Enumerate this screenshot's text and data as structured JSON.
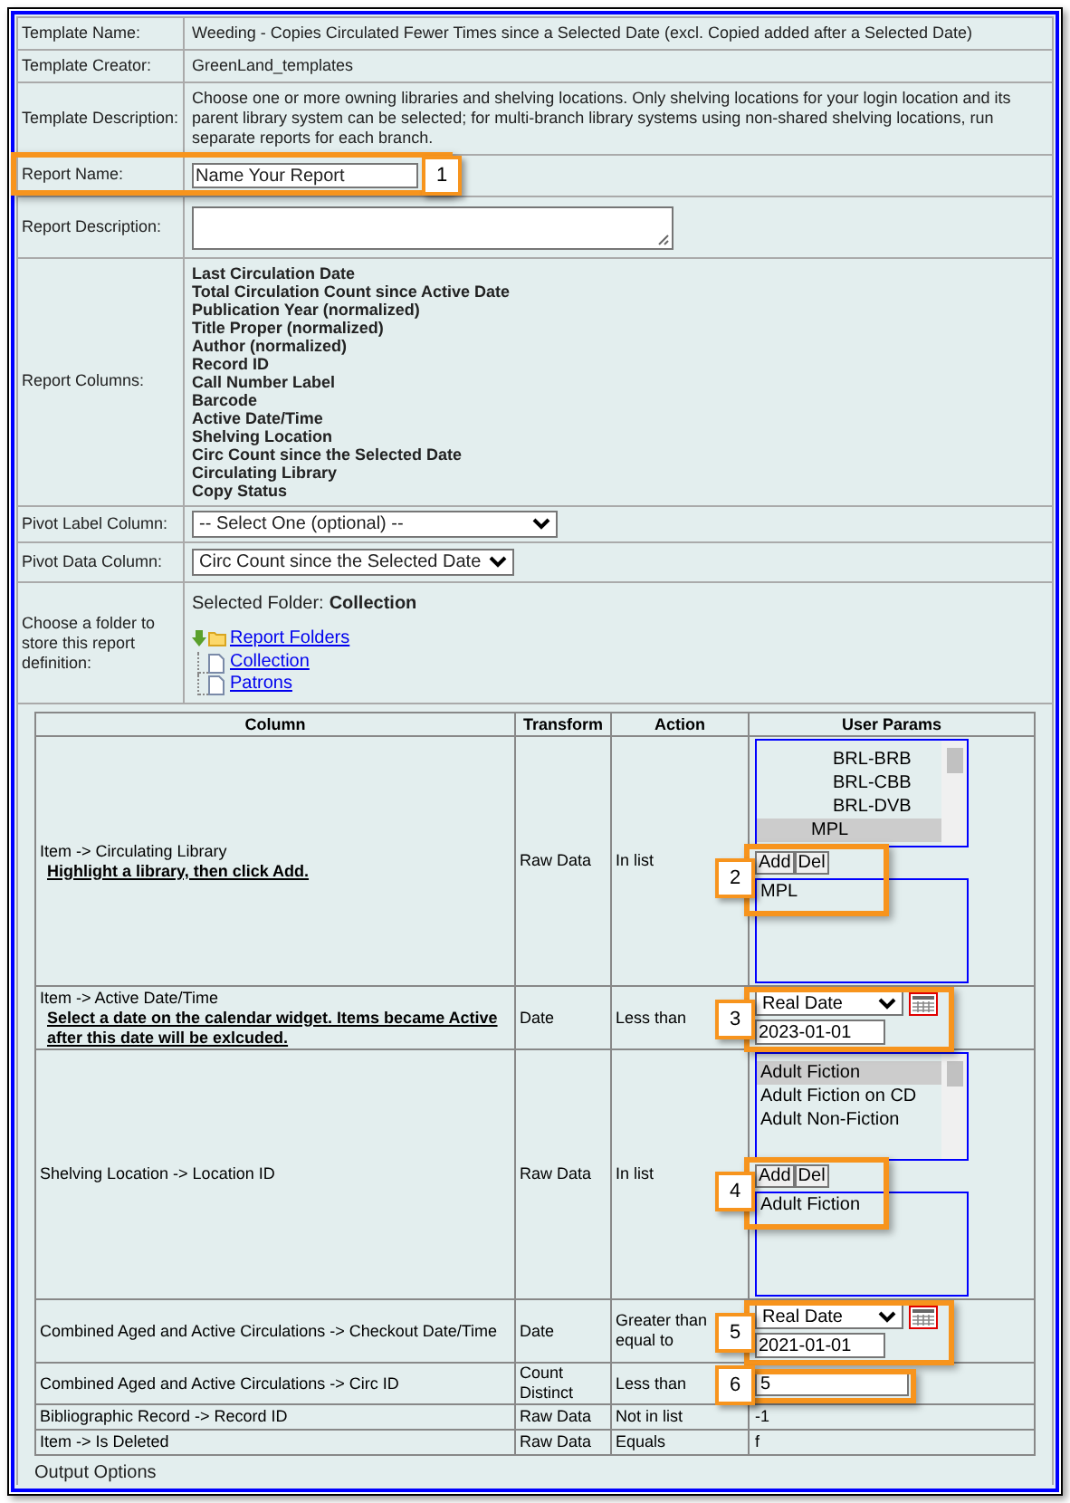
{
  "info_rows": [
    {
      "label": "Template Name:",
      "value": "Weeding - Copies Circulated Fewer Times since a Selected Date (excl. Copied added after a Selected Date)"
    },
    {
      "label": "Template Creator:",
      "value": "GreenLand_templates"
    },
    {
      "label": "Template Description:",
      "value": "Choose one or more owning libraries and shelving locations. Only shelving locations for your login location and its parent library system can be selected; for multi-branch library systems using non-shared shelving locations, run separate reports for each branch."
    }
  ],
  "report_name": {
    "label": "Report Name:",
    "value": "Name Your Report",
    "callout": "1"
  },
  "report_description": {
    "label": "Report Description:"
  },
  "report_columns": {
    "label": "Report Columns:",
    "items": [
      "Last Circulation Date",
      "Total Circulation Count since Active Date",
      "Publication Year (normalized)",
      "Title Proper (normalized)",
      "Author (normalized)",
      "Record ID",
      "Call Number Label",
      "Barcode",
      "Active Date/Time",
      "Shelving Location",
      "Circ Count since the Selected Date",
      "Circulating Library",
      "Copy Status"
    ]
  },
  "pivot_label": {
    "label": "Pivot Label Column:",
    "value": "-- Select One (optional) --"
  },
  "pivot_data": {
    "label": "Pivot Data Column:",
    "value": "Circ Count since the Selected Date"
  },
  "folder": {
    "label": "Choose a folder to store this report definition:",
    "selected_label": "Selected Folder:",
    "selected_value": "Collection",
    "tree": {
      "label": "Report Folders",
      "children": [
        {
          "label": "Collection"
        },
        {
          "label": "Patrons"
        }
      ]
    }
  },
  "params_table": {
    "columns": [
      "Column",
      "Transform",
      "Action",
      "User Params"
    ],
    "rows": [
      {
        "column": "Item -> Circulating Library",
        "hint": "Highlight a library, then click Add.",
        "transform": "Raw Data",
        "action": "In list",
        "callout": "2",
        "param": {
          "kind": "listbox",
          "options": [
            {
              "label": "BRL-BRB",
              "selected": false
            },
            {
              "label": "BRL-CBB",
              "selected": false
            },
            {
              "label": "BRL-DVB",
              "selected": false
            },
            {
              "label": "MPL",
              "selected": true
            }
          ],
          "add": "Add",
          "del": "Del",
          "chosen": [
            "MPL"
          ],
          "centered": true
        }
      },
      {
        "column": "Item -> Active Date/Time",
        "hint": "Select a date on the calendar widget. Items became Active after this date will be exlcuded.",
        "transform": "Date",
        "action": "Less than",
        "callout": "3",
        "param": {
          "kind": "date",
          "type": "Real Date",
          "value": "2023-01-01"
        }
      },
      {
        "column": "Shelving Location -> Location ID",
        "transform": "Raw Data",
        "action": "In list",
        "callout": "4",
        "param": {
          "kind": "listbox",
          "options": [
            {
              "label": "Adult Fiction",
              "selected": true
            },
            {
              "label": "Adult Fiction on CD",
              "selected": false
            },
            {
              "label": "Adult Non-Fiction",
              "selected": false
            }
          ],
          "add": "Add",
          "del": "Del",
          "chosen": [
            "Adult Fiction"
          ],
          "centered": false
        }
      },
      {
        "column": "Combined Aged and Active Circulations -> Checkout Date/Time",
        "transform": "Date",
        "action": "Greater than equal to",
        "callout": "5",
        "param": {
          "kind": "date",
          "type": "Real Date",
          "value": "2021-01-01"
        }
      },
      {
        "column": "Combined Aged and Active Circulations -> Circ ID",
        "transform": "Count Distinct",
        "action": "Less than",
        "callout": "6",
        "param": {
          "kind": "text",
          "value": "5"
        }
      },
      {
        "column": "Bibliographic Record -> Record ID",
        "transform": "Raw Data",
        "action": "Not in list",
        "param": {
          "kind": "plain",
          "value": "-1"
        }
      },
      {
        "column": "Item -> Is Deleted",
        "transform": "Raw Data",
        "action": "Equals",
        "param": {
          "kind": "plain",
          "value": "f"
        }
      }
    ]
  },
  "output_options": "Output Options"
}
